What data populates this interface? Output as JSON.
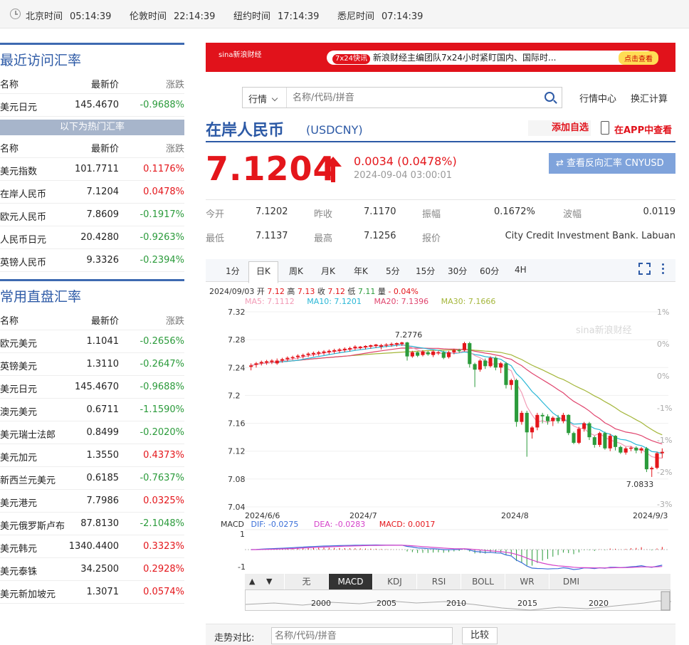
{
  "clocks": [
    {
      "city": "北京时间",
      "time": "05:14:39"
    },
    {
      "city": "伦敦时间",
      "time": "22:14:39"
    },
    {
      "city": "纽约时间",
      "time": "17:14:39"
    },
    {
      "city": "悉尼时间",
      "time": "07:14:39"
    }
  ],
  "recent": {
    "title": "最近访问汇率",
    "headers": [
      "名称",
      "最新价",
      "涨跌"
    ],
    "rows": [
      [
        "美元日元",
        "145.4670",
        "-0.9688%"
      ]
    ]
  },
  "hot": {
    "bar": "以下为热门汇率",
    "headers": [
      "名称",
      "最新价",
      "涨跌"
    ],
    "rows": [
      [
        "美元指数",
        "101.7711",
        "0.1176%"
      ],
      [
        "在岸人民币",
        "7.1204",
        "0.0478%"
      ],
      [
        "欧元人民币",
        "7.8609",
        "-0.1917%"
      ],
      [
        "人民币日元",
        "20.4280",
        "-0.9263%"
      ],
      [
        "英镑人民币",
        "9.3326",
        "-0.2394%"
      ]
    ]
  },
  "cross": {
    "title": "常用直盘汇率",
    "headers": [
      "名称",
      "最新价",
      "涨跌"
    ],
    "rows": [
      [
        "欧元美元",
        "1.1041",
        "-0.2656%"
      ],
      [
        "英镑美元",
        "1.3110",
        "-0.2647%"
      ],
      [
        "美元日元",
        "145.4670",
        "-0.9688%"
      ],
      [
        "澳元美元",
        "0.6711",
        "-1.1590%"
      ],
      [
        "美元瑞士法郎",
        "0.8499",
        "-0.2020%"
      ],
      [
        "美元加元",
        "1.3550",
        "0.4373%"
      ],
      [
        "新西兰元美元",
        "0.6185",
        "-0.7637%"
      ],
      [
        "美元港元",
        "7.7986",
        "0.0325%"
      ],
      [
        "美元俄罗斯卢布",
        "87.8130",
        "-2.1048%"
      ],
      [
        "美元韩元",
        "1340.4400",
        "0.3323%"
      ],
      [
        "美元泰铢",
        "34.2500",
        "0.2928%"
      ],
      [
        "美元新加坡元",
        "1.3071",
        "0.0574%"
      ]
    ]
  },
  "ad": {
    "logo": "sina新浪财经",
    "tag": "7x24快讯",
    "text": "新浪财经主编团队7x24小时紧盯国内、国际时...",
    "button": "点击查看"
  },
  "search": {
    "select": "行情",
    "placeholder": "名称/代码/拼音"
  },
  "links": {
    "market": "行情中心",
    "convert": "换汇计算"
  },
  "product": {
    "name": "在岸人民币",
    "code": "(USDCNY)",
    "add_fav": "添加自选",
    "app": "在APP中查看",
    "price": "7.1204",
    "change": "0.0034 (0.0478%)",
    "timestamp": "2024-09-04 03:00:01",
    "reverse_button": "查看反向汇率 CNYUSD"
  },
  "stats": {
    "row1": [
      [
        "今开",
        "7.1202"
      ],
      [
        "昨收",
        "7.1170"
      ],
      [
        "振幅",
        "0.1672%"
      ],
      [
        "波幅",
        "0.0119"
      ]
    ],
    "row2": [
      [
        "最低",
        "7.1137"
      ],
      [
        "最高",
        "7.1256"
      ],
      [
        "报价",
        "City Credit Investment Bank. Labuan"
      ]
    ]
  },
  "tabs": [
    "1分",
    "日K",
    "周K",
    "月K",
    "年K",
    "5分",
    "15分",
    "30分",
    "60分",
    "4H"
  ],
  "ohlc": {
    "date": "2024/09/03",
    "o_l": "开",
    "o": "7.12",
    "h_l": "高",
    "h": "7.13",
    "c_l": "收",
    "c": "7.12",
    "l_l": "低",
    "l": "7.11",
    "v_l": "量",
    "v": "-",
    "chg": "0.04%"
  },
  "ma": [
    {
      "name": "MA5",
      "value": "7.1112",
      "color": "#f29bb6"
    },
    {
      "name": "MA10",
      "value": "7.1201",
      "color": "#29b7d6"
    },
    {
      "name": "MA20",
      "value": "7.1396",
      "color": "#e0456e"
    },
    {
      "name": "MA30",
      "value": "7.1666",
      "color": "#a4b63a"
    }
  ],
  "chart_data": {
    "type": "candlestick",
    "y_ticks": [
      "7.32",
      "7.28",
      "7.24",
      "7.2",
      "7.16",
      "7.12",
      "7.08",
      "7.04"
    ],
    "y_range": [
      7.04,
      7.32
    ],
    "right_ticks": [
      "1%",
      "0%",
      "0%",
      "-1%",
      "-1%",
      "-2%",
      "-3%"
    ],
    "x_ticks": [
      "2024/6/6",
      "2024/7",
      "2024/8",
      "2024/9/3"
    ],
    "annotations": {
      "max": "7.2776",
      "min": "7.0833"
    },
    "watermark": "sina新浪财经",
    "candles": [
      [
        7.241,
        7.243,
        7.236,
        7.246
      ],
      [
        7.244,
        7.246,
        7.24,
        7.248
      ],
      [
        7.246,
        7.248,
        7.243,
        7.25
      ],
      [
        7.247,
        7.249,
        7.244,
        7.251
      ],
      [
        7.248,
        7.25,
        7.245,
        7.252
      ],
      [
        7.246,
        7.25,
        7.244,
        7.253
      ],
      [
        7.25,
        7.252,
        7.247,
        7.254
      ],
      [
        7.252,
        7.254,
        7.249,
        7.256
      ],
      [
        7.254,
        7.255,
        7.251,
        7.257
      ],
      [
        7.255,
        7.257,
        7.252,
        7.259
      ],
      [
        7.256,
        7.258,
        7.253,
        7.26
      ],
      [
        7.258,
        7.26,
        7.255,
        7.262
      ],
      [
        7.259,
        7.261,
        7.256,
        7.263
      ],
      [
        7.26,
        7.262,
        7.257,
        7.264
      ],
      [
        7.261,
        7.263,
        7.258,
        7.265
      ],
      [
        7.262,
        7.264,
        7.259,
        7.266
      ],
      [
        7.263,
        7.265,
        7.26,
        7.267
      ],
      [
        7.264,
        7.266,
        7.261,
        7.268
      ],
      [
        7.265,
        7.267,
        7.262,
        7.269
      ],
      [
        7.266,
        7.268,
        7.263,
        7.27
      ],
      [
        7.268,
        7.27,
        7.265,
        7.272
      ],
      [
        7.268,
        7.27,
        7.266,
        7.271
      ],
      [
        7.269,
        7.271,
        7.266,
        7.272
      ],
      [
        7.27,
        7.272,
        7.267,
        7.273
      ],
      [
        7.271,
        7.273,
        7.268,
        7.274
      ],
      [
        7.27,
        7.272,
        7.266,
        7.274
      ],
      [
        7.272,
        7.273,
        7.269,
        7.275
      ],
      [
        7.273,
        7.274,
        7.27,
        7.276
      ],
      [
        7.273,
        7.275,
        7.27,
        7.276
      ],
      [
        7.274,
        7.276,
        7.271,
        7.277
      ],
      [
        7.276,
        7.256,
        7.25,
        7.277
      ],
      [
        7.256,
        7.262,
        7.254,
        7.264
      ],
      [
        7.262,
        7.257,
        7.255,
        7.263
      ],
      [
        7.258,
        7.263,
        7.256,
        7.265
      ],
      [
        7.262,
        7.259,
        7.257,
        7.264
      ],
      [
        7.258,
        7.263,
        7.255,
        7.265
      ],
      [
        7.262,
        7.262,
        7.258,
        7.264
      ],
      [
        7.262,
        7.254,
        7.252,
        7.264
      ],
      [
        7.255,
        7.262,
        7.253,
        7.264
      ],
      [
        7.262,
        7.265,
        7.259,
        7.267
      ],
      [
        7.265,
        7.264,
        7.261,
        7.267
      ],
      [
        7.265,
        7.275,
        7.263,
        7.277
      ],
      [
        7.275,
        7.245,
        7.24,
        7.277
      ],
      [
        7.245,
        7.237,
        7.212,
        7.247
      ],
      [
        7.237,
        7.25,
        7.234,
        7.252
      ],
      [
        7.25,
        7.242,
        7.238,
        7.253
      ],
      [
        7.242,
        7.254,
        7.24,
        7.256
      ],
      [
        7.254,
        7.24,
        7.236,
        7.256
      ],
      [
        7.24,
        7.246,
        7.232,
        7.248
      ],
      [
        7.246,
        7.215,
        7.21,
        7.248
      ],
      [
        7.215,
        7.222,
        7.208,
        7.224
      ],
      [
        7.222,
        7.162,
        7.155,
        7.224
      ],
      [
        7.162,
        7.175,
        7.158,
        7.178
      ],
      [
        7.175,
        7.147,
        7.112,
        7.178
      ],
      [
        7.147,
        7.154,
        7.138,
        7.156
      ],
      [
        7.154,
        7.172,
        7.15,
        7.175
      ],
      [
        7.172,
        7.17,
        7.16,
        7.175
      ],
      [
        7.17,
        7.163,
        7.158,
        7.173
      ],
      [
        7.163,
        7.168,
        7.156,
        7.17
      ],
      [
        7.168,
        7.163,
        7.16,
        7.172
      ],
      [
        7.163,
        7.172,
        7.16,
        7.175
      ],
      [
        7.172,
        7.146,
        7.143,
        7.173
      ],
      [
        7.146,
        7.132,
        7.13,
        7.148
      ],
      [
        7.132,
        7.152,
        7.13,
        7.155
      ],
      [
        7.152,
        7.16,
        7.148,
        7.162
      ],
      [
        7.16,
        7.14,
        7.136,
        7.162
      ],
      [
        7.14,
        7.129,
        7.125,
        7.142
      ],
      [
        7.129,
        7.146,
        7.126,
        7.148
      ],
      [
        7.146,
        7.124,
        7.122,
        7.148
      ],
      [
        7.124,
        7.142,
        7.12,
        7.145
      ],
      [
        7.142,
        7.126,
        7.121,
        7.143
      ],
      [
        7.126,
        7.118,
        7.116,
        7.128
      ],
      [
        7.118,
        7.124,
        7.115,
        7.126
      ],
      [
        7.124,
        7.125,
        7.12,
        7.127
      ],
      [
        7.125,
        7.121,
        7.117,
        7.127
      ],
      [
        7.121,
        7.124,
        7.117,
        7.126
      ],
      [
        7.124,
        7.094,
        7.09,
        7.126
      ],
      [
        7.094,
        7.096,
        7.083,
        7.098
      ],
      [
        7.096,
        7.117,
        7.094,
        7.119
      ],
      [
        7.117,
        7.119,
        7.11,
        7.124
      ]
    ]
  },
  "macd": {
    "label": "MACD",
    "dif": "DIF: -0.0275",
    "dea": "DEA: -0.0283",
    "macd": "MACD: 0.0017",
    "ticks": [
      "1",
      "-1"
    ]
  },
  "indicator_tabs": [
    "无",
    "MACD",
    "KDJ",
    "RSI",
    "BOLL",
    "WR",
    "DMI"
  ],
  "range_years": [
    "2000",
    "2005",
    "2010",
    "2015",
    "2020"
  ],
  "compare": {
    "label": "走势对比:",
    "placeholder": "名称/代码/拼音",
    "button": "比较"
  }
}
